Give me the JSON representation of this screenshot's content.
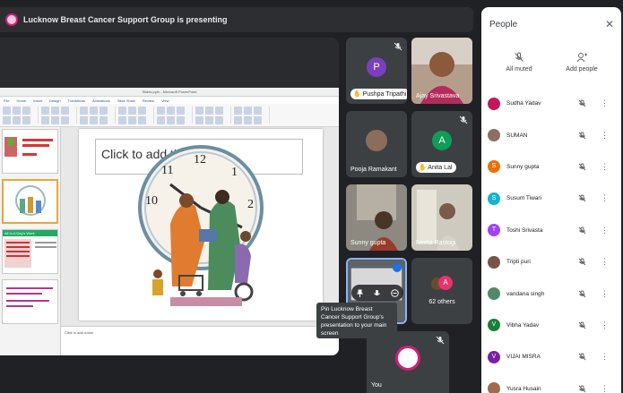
{
  "presenting_bar": {
    "text": "Lucknow Breast Cancer Support Group is presenting"
  },
  "presentation": {
    "window_title": "Slides.pptx - Microsoft PowerPoint",
    "menu": [
      "File",
      "Home",
      "Insert",
      "Design",
      "Transitions",
      "Animations",
      "Slide Show",
      "Review",
      "View"
    ],
    "slide_placeholder": "Click to add title",
    "notes_placeholder": "Click to add notes",
    "thumb3_title": "All In A Day's Work"
  },
  "tiles": [
    {
      "name": "Pushpa Tripathi",
      "initial": "P",
      "color": "#7b3fbf"
    },
    {
      "name": "Ajay Srivastava"
    },
    {
      "name": "Pooja Ramakant"
    },
    {
      "name": "Anita Lal",
      "initial": "A",
      "color": "#0f9d58"
    },
    {
      "name": "Sunny gupta"
    },
    {
      "name": "Neeta Rastogi"
    },
    {
      "others_label": "62 others",
      "initial": "A",
      "color": "#e8336e"
    },
    {
      "name": "You"
    }
  ],
  "tooltip": {
    "text": "Pin Lucknow Breast Cancer Support Group's presentation to your main screen"
  },
  "people_panel": {
    "title": "People",
    "close_icon": "close-icon",
    "all_muted_label": "All muted",
    "add_people_label": "Add people",
    "participants": [
      {
        "name": "Sudha Yadav",
        "avatar": "photo",
        "color": "#c2185b"
      },
      {
        "name": "SUMAN",
        "avatar": "photo",
        "color": "#8d6e63"
      },
      {
        "name": "Sunny gupta",
        "avatar": "S",
        "color": "#e8710a"
      },
      {
        "name": "Susum Tiwari",
        "avatar": "S",
        "color": "#12b5cb"
      },
      {
        "name": "Toshi Srivasta",
        "avatar": "T",
        "color": "#a142f4"
      },
      {
        "name": "Tripti puri",
        "avatar": "photo",
        "color": "#795548"
      },
      {
        "name": "vandana singh",
        "avatar": "photo",
        "color": "#4e8a6b"
      },
      {
        "name": "Vibha Yadav",
        "avatar": "V",
        "color": "#188038"
      },
      {
        "name": "VIJAI MISRA",
        "avatar": "V",
        "color": "#7b1fa2"
      },
      {
        "name": "Yusra Husain",
        "avatar": "photo",
        "color": "#9e6b4f"
      }
    ]
  },
  "colors": {
    "background": "#202124",
    "tile": "#3c4043",
    "panel": "#ffffff",
    "brand": "#d21e77"
  }
}
